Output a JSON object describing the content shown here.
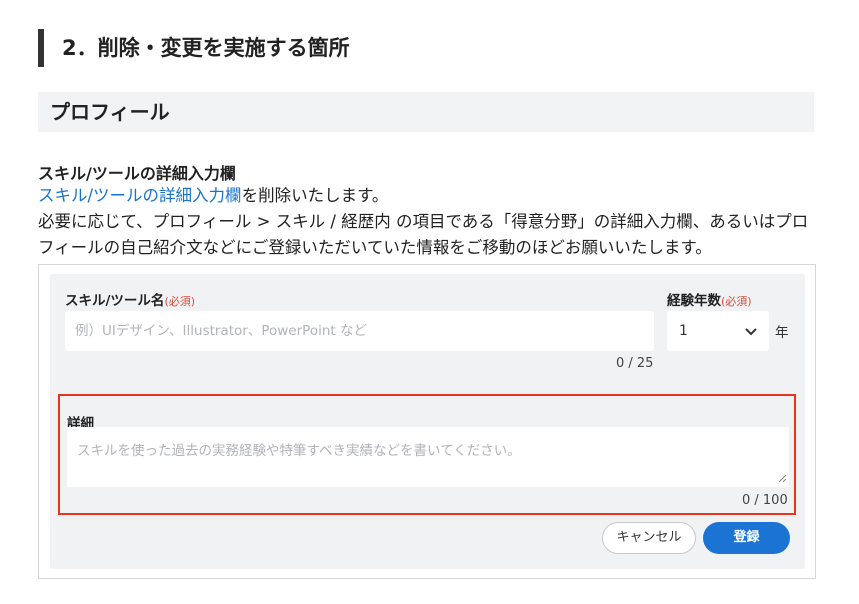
{
  "section_heading": "2．削除・変更を実施する箇所",
  "profile_heading": "プロフィール",
  "subtitle": "スキル/ツールの詳細入力欄",
  "paragraph": {
    "link": "スキル/ツールの詳細入力欄",
    "line1_rest": "を削除いたします。",
    "line2": "必要に応じて、プロフィール > スキル / 経歴内 の項目である「得意分野」の詳細入力欄、あるいはプロフィールの自己紹介文などにご登録いただいていた情報をご移動のほどお願いいたします。"
  },
  "form": {
    "skill_label": "スキル/ツール名",
    "required": "(必須)",
    "skill_placeholder": "例）UIデザイン、Illustrator、PowerPoint など",
    "skill_counter": "0 / 25",
    "exp_label": "経験年数",
    "exp_value": "1",
    "exp_unit": "年",
    "detail_label": "詳細",
    "detail_placeholder": "スキルを使った過去の実務経験や特筆すべき実績などを書いてください。",
    "detail_counter": "0 / 100",
    "cancel_label": "キャンセル",
    "submit_label": "登録"
  },
  "colors": {
    "accent": "#1b73d3",
    "link": "#1a73c9",
    "required": "#e04a3a",
    "highlight": "#e8341c"
  },
  "icons": {
    "select": "chevron-down-icon",
    "resize": "resize-grip-icon"
  }
}
